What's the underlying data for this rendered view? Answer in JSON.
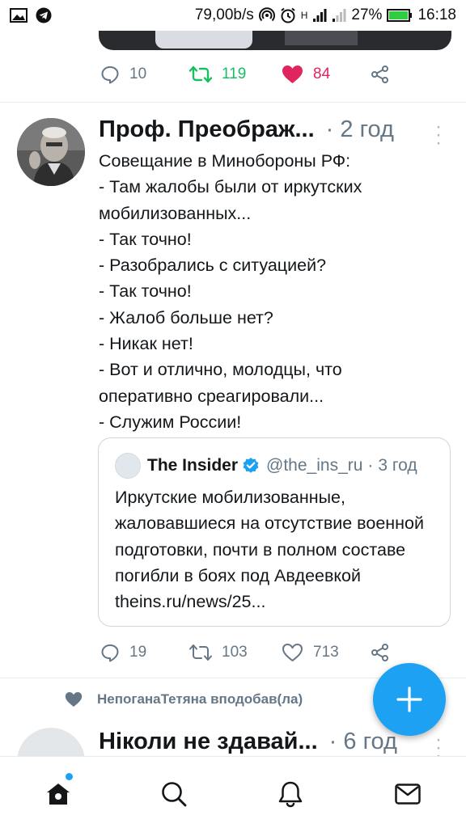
{
  "status_bar": {
    "network_speed": "79,00b/s",
    "net_type": "H",
    "battery": "27%",
    "time": "16:18",
    "icons": [
      "image-icon",
      "telegram-icon",
      "hotspot-icon",
      "alarm-icon",
      "signal-icon",
      "signal-weak-icon",
      "battery-icon"
    ]
  },
  "previous_tweet": {
    "replies": "10",
    "retweets": "119",
    "likes": "84",
    "retweet_color": "#17bf63",
    "like_color": "#e0245e"
  },
  "tweet": {
    "author_name": "Проф. Преображ...",
    "time_sep": "·",
    "time": "2 год",
    "text": "Совещание в Минобороны РФ:\n- Там жалобы были от иркутских мобилизованных...\n- Так точно!\n- Разобрались с ситуацией?\n- Так точно!\n- Жалоб больше нет?\n- Никак нет!\n- Вот и отлично, молодцы, что оперативно среагировали...\n- Служим России!",
    "quoted": {
      "name": "The Insider",
      "handle": "@the_ins_ru",
      "time_sep": "·",
      "time": "3 год",
      "text": "Иркутские мобилизованные, жаловавшиеся на отсутствие военной подготовки, почти в полном составе погибли в боях под Авдеевкой theins.ru/news/25..."
    },
    "replies": "19",
    "retweets": "103",
    "likes": "713"
  },
  "liked_by": {
    "text": "НепоганаТетяна вподобав(ла)"
  },
  "next_tweet": {
    "author_name": "Ніколи не здавай...",
    "time_sep": "·",
    "time": "6 год"
  },
  "fab": {
    "icon": "plus-icon"
  },
  "bottom_nav": {
    "items": [
      "home-icon",
      "search-icon",
      "bell-icon",
      "mail-icon"
    ],
    "accent_color": "#1da1f2"
  }
}
